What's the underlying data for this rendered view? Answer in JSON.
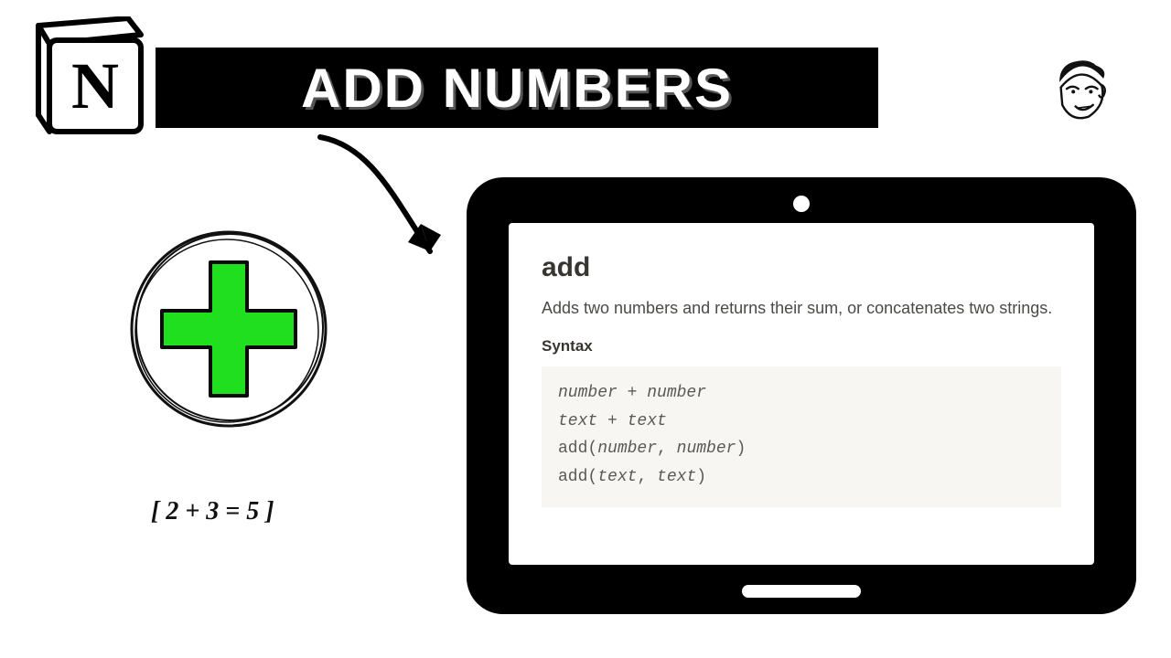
{
  "header": {
    "title": "ADD NUMBERS"
  },
  "logo": {
    "letter": "N"
  },
  "equation": "[ 2 + 3 = 5 ]",
  "doc": {
    "title": "add",
    "description": "Adds two numbers and returns their sum, or concatenates two strings.",
    "syntax_label": "Syntax",
    "code_lines": [
      "number + number",
      "text + text",
      "add(number, number)",
      "add(text, text)"
    ]
  }
}
